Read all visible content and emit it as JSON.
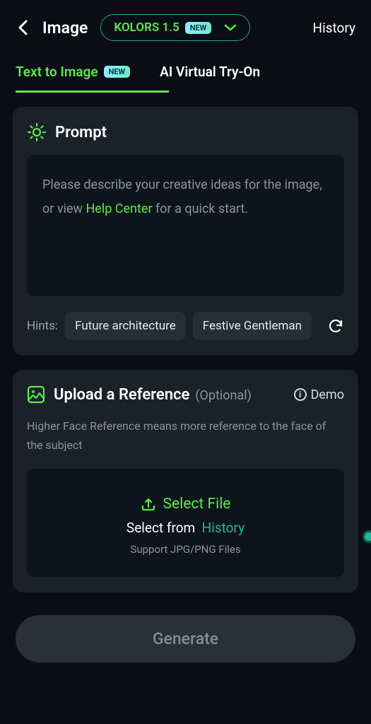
{
  "header": {
    "title": "Image",
    "model": "KOLORS 1.5",
    "model_badge": "NEW",
    "history": "History"
  },
  "tabs": {
    "t1": {
      "label": "Text to Image",
      "badge": "NEW"
    },
    "t2": {
      "label": "AI Virtual Try-On"
    }
  },
  "prompt": {
    "title": "Prompt",
    "placeholder_pre": "Please describe your creative ideas for the image, or view ",
    "help": "Help Center",
    "placeholder_post": " for a quick start.",
    "hints_label": "Hints:",
    "hint1": "Future architecture",
    "hint2": "Festive Gentleman"
  },
  "upload": {
    "title": "Upload a Reference",
    "optional": "(Optional)",
    "demo": "Demo",
    "desc": "Higher Face Reference means more reference to the face of the subject",
    "select_file": "Select File",
    "select_from": "Select from",
    "history": "History",
    "support": "Support JPG/PNG Files"
  },
  "generate": "Generate"
}
